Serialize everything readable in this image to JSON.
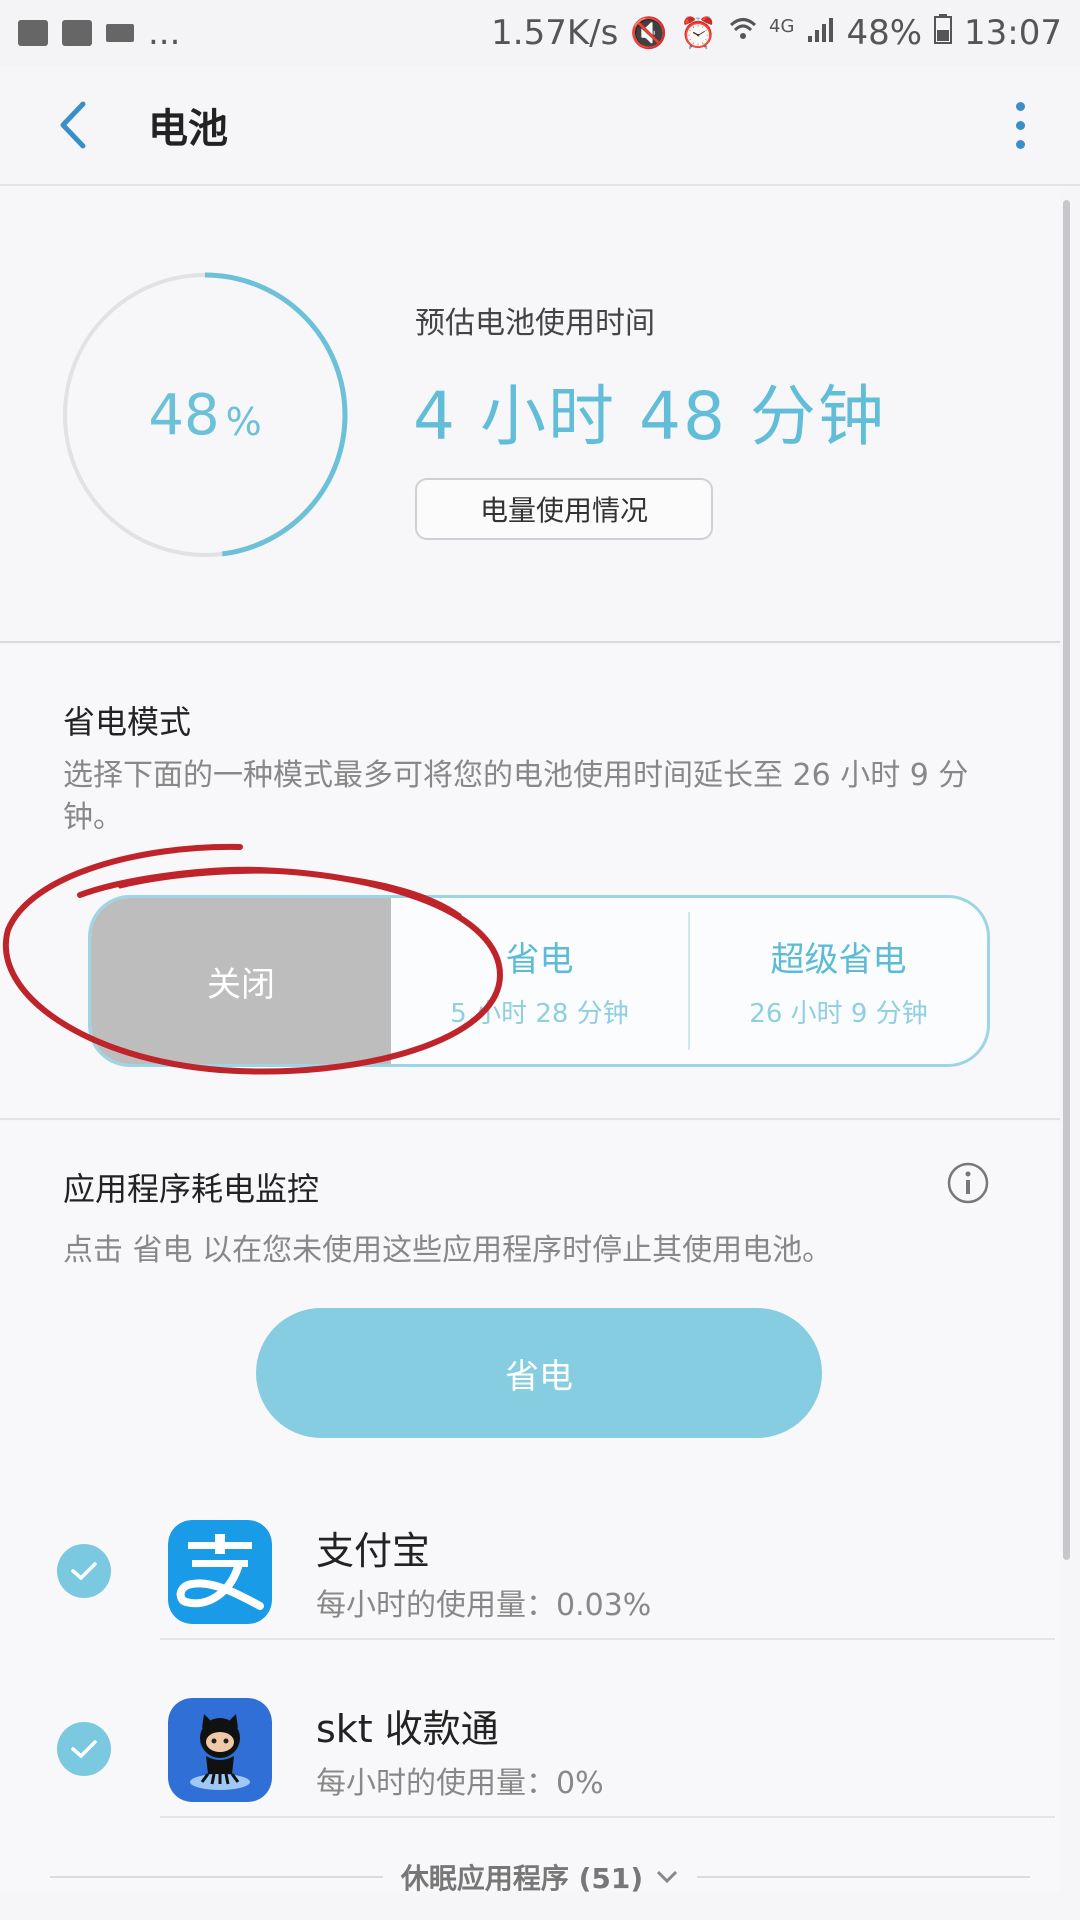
{
  "status_bar": {
    "left_more": "...",
    "speed": "1.57K/s",
    "network": "4G",
    "battery": "48%",
    "time": "13:07"
  },
  "app_bar": {
    "title": "电池"
  },
  "battery_card": {
    "percent": "48",
    "percent_sign": "%",
    "level": 0.48,
    "estimate_label": "预估电池使用时间",
    "estimate_value": "4 小时 48 分钟",
    "usage_button": "电量使用情况",
    "accent_color": "#6cc0d8"
  },
  "power_mode": {
    "title": "省电模式",
    "description": "选择下面的一种模式最多可将您的电池使用时间延长至 26 小时 9 分钟。",
    "modes": [
      {
        "label": "关闭",
        "sub": ""
      },
      {
        "label": "省电",
        "sub": "5 小时 28 分钟"
      },
      {
        "label": "超级省电",
        "sub": "26 小时 9 分钟"
      }
    ],
    "selected": "关闭"
  },
  "app_monitor": {
    "title": "应用程序耗电监控",
    "description": "点击 省电 以在您未使用这些应用程序时停止其使用电池。",
    "save_button": "省电",
    "apps": [
      {
        "name": "支付宝",
        "usage": "每小时的使用量：0.03%",
        "checked": true,
        "icon": "alipay-icon"
      },
      {
        "name": "skt 收款通",
        "usage": "每小时的使用量：0%",
        "checked": true,
        "icon": "octocat-icon"
      }
    ],
    "sleeping_apps": "休眠应用程序 (51)"
  }
}
